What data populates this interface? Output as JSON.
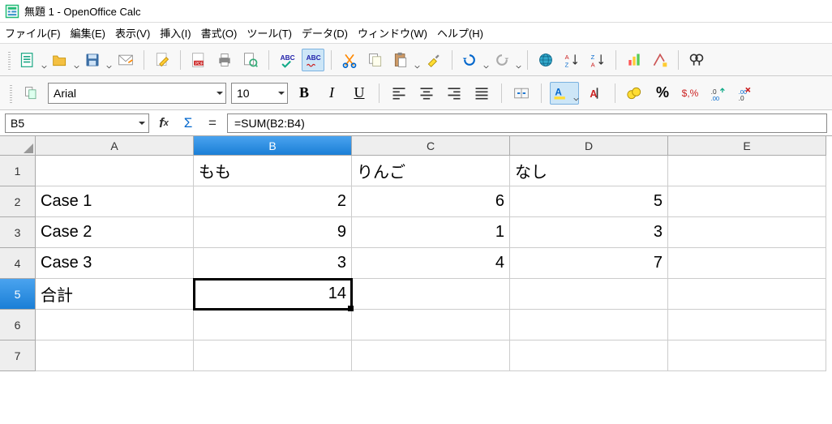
{
  "window": {
    "title": "無題 1 - OpenOffice Calc"
  },
  "menu": {
    "file": "ファイル(F)",
    "edit": "編集(E)",
    "view": "表示(V)",
    "insert": "挿入(I)",
    "format": "書式(O)",
    "tools": "ツール(T)",
    "data": "データ(D)",
    "window": "ウィンドウ(W)",
    "help": "ヘルプ(H)"
  },
  "format_toolbar": {
    "font": "Arial",
    "size": "10"
  },
  "formula_bar": {
    "cell_ref": "B5",
    "formula": "=SUM(B2:B4)"
  },
  "sheet": {
    "columns": [
      "A",
      "B",
      "C",
      "D",
      "E"
    ],
    "selected_col": "B",
    "selected_row": "5",
    "selected_cell": "B5",
    "rows": [
      {
        "r": "1",
        "A": "",
        "B": "もも",
        "C": "りんご",
        "D": "なし",
        "E": ""
      },
      {
        "r": "2",
        "A": "Case 1",
        "B": "2",
        "C": "6",
        "D": "5",
        "E": ""
      },
      {
        "r": "3",
        "A": "Case 2",
        "B": "9",
        "C": "1",
        "D": "3",
        "E": ""
      },
      {
        "r": "4",
        "A": "Case 3",
        "B": "3",
        "C": "4",
        "D": "7",
        "E": ""
      },
      {
        "r": "5",
        "A": "合計",
        "B": "14",
        "C": "",
        "D": "",
        "E": ""
      },
      {
        "r": "6",
        "A": "",
        "B": "",
        "C": "",
        "D": "",
        "E": ""
      },
      {
        "r": "7",
        "A": "",
        "B": "",
        "C": "",
        "D": "",
        "E": ""
      }
    ]
  }
}
